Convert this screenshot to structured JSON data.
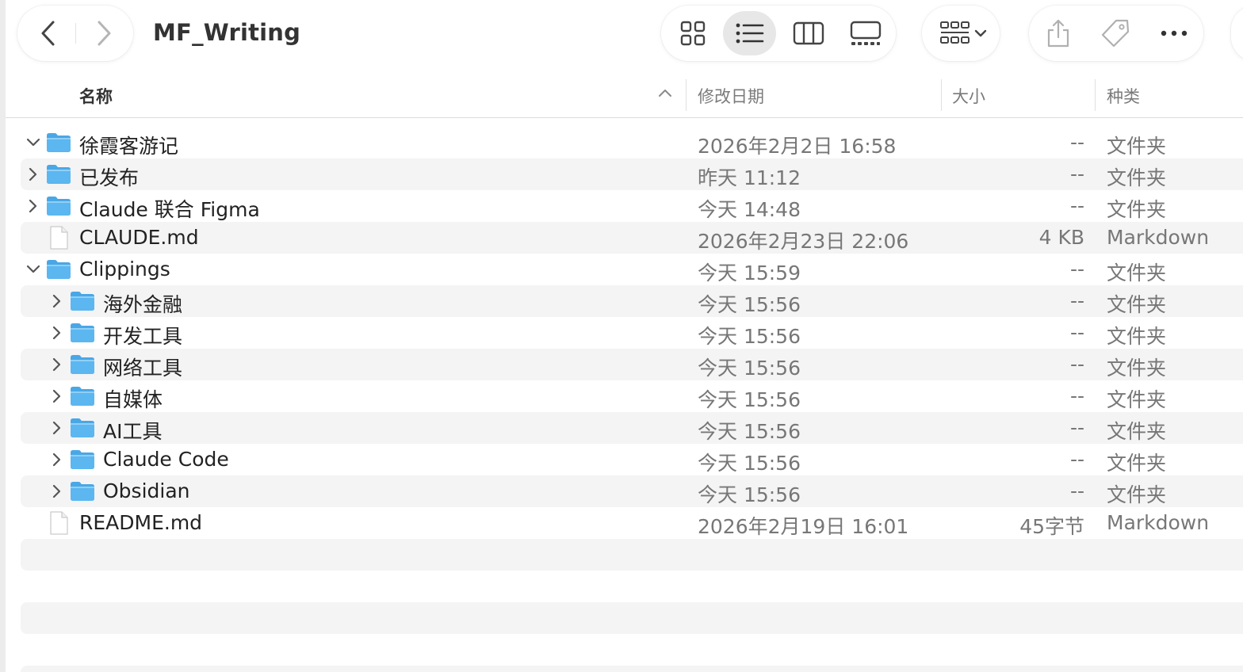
{
  "window": {
    "title": "MF_Writing"
  },
  "toolbar": {
    "back_icon": "chevron-left-icon",
    "forward_icon": "chevron-right-icon",
    "view_modes": [
      {
        "name": "icon-view",
        "icon": "grid-icon",
        "active": false
      },
      {
        "name": "list-view",
        "icon": "list-icon",
        "active": true
      },
      {
        "name": "column-view",
        "icon": "columns-icon",
        "active": false
      },
      {
        "name": "gallery-view",
        "icon": "gallery-icon",
        "active": false
      }
    ],
    "group_icon": "group-by-icon",
    "share_icon": "share-icon",
    "tag_icon": "tag-icon",
    "more_icon": "ellipsis-icon"
  },
  "columns": {
    "name": "名称",
    "date": "修改日期",
    "size": "大小",
    "kind": "种类",
    "sort_indicator": "chevron-up-icon"
  },
  "rows": [
    {
      "name": "徐霞客游记",
      "date": "2026年2月2日 16:58",
      "size": "--",
      "kind": "文件夹",
      "type": "folder",
      "level": 0,
      "expanded": true
    },
    {
      "name": "已发布",
      "date": "昨天 11:12",
      "size": "--",
      "kind": "文件夹",
      "type": "folder",
      "level": 0,
      "expanded": false
    },
    {
      "name": "Claude 联合 Figma",
      "date": "今天 14:48",
      "size": "--",
      "kind": "文件夹",
      "type": "folder",
      "level": 0,
      "expanded": false
    },
    {
      "name": "CLAUDE.md",
      "date": "2026年2月23日 22:06",
      "size": "4 KB",
      "kind": "Markdown",
      "type": "file",
      "level": 0,
      "expanded": false
    },
    {
      "name": "Clippings",
      "date": "今天 15:59",
      "size": "--",
      "kind": "文件夹",
      "type": "folder",
      "level": 0,
      "expanded": true
    },
    {
      "name": "海外金融",
      "date": "今天 15:56",
      "size": "--",
      "kind": "文件夹",
      "type": "folder",
      "level": 1,
      "expanded": false
    },
    {
      "name": "开发工具",
      "date": "今天 15:56",
      "size": "--",
      "kind": "文件夹",
      "type": "folder",
      "level": 1,
      "expanded": false
    },
    {
      "name": "网络工具",
      "date": "今天 15:56",
      "size": "--",
      "kind": "文件夹",
      "type": "folder",
      "level": 1,
      "expanded": false
    },
    {
      "name": "自媒体",
      "date": "今天 15:56",
      "size": "--",
      "kind": "文件夹",
      "type": "folder",
      "level": 1,
      "expanded": false
    },
    {
      "name": "AI工具",
      "date": "今天 15:56",
      "size": "--",
      "kind": "文件夹",
      "type": "folder",
      "level": 1,
      "expanded": false
    },
    {
      "name": "Claude Code",
      "date": "今天 15:56",
      "size": "--",
      "kind": "文件夹",
      "type": "folder",
      "level": 1,
      "expanded": false
    },
    {
      "name": "Obsidian",
      "date": "今天 15:56",
      "size": "--",
      "kind": "文件夹",
      "type": "folder",
      "level": 1,
      "expanded": false
    },
    {
      "name": "README.md",
      "date": "2026年2月19日 16:01",
      "size": "45字节",
      "kind": "Markdown",
      "type": "file",
      "level": 0,
      "expanded": false
    }
  ],
  "colors": {
    "folder": "#5cb6f0",
    "folder_tab": "#4aa7e6",
    "stripe": "#f4f4f5",
    "secondary_text": "#777777"
  }
}
